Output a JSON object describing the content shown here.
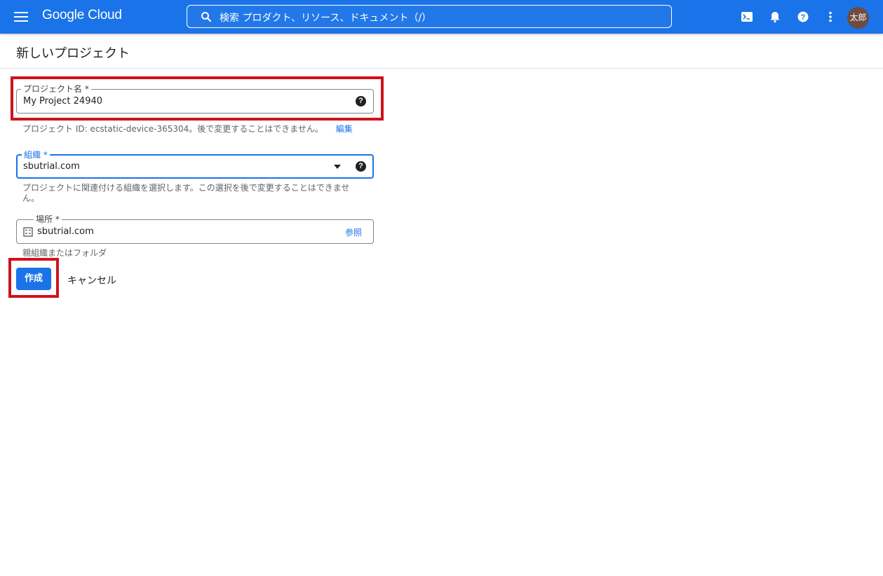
{
  "header": {
    "logo": "Google Cloud",
    "search_placeholder": "検索  プロダクト、リソース、ドキュメント（/）",
    "avatar_text": "太郎"
  },
  "page": {
    "title": "新しいプロジェクト"
  },
  "form": {
    "project_name": {
      "label": "プロジェクト名 *",
      "value": "My Project 24940",
      "hint_prefix": "プロジェクト ID: ecstatic-device-365304。後で変更することはできません。",
      "hint_link": "編集"
    },
    "organization": {
      "label": "組織 *",
      "value": "sbutrial.com",
      "hint_line1": "プロジェクトに関連付ける組織を選択します。この選択を後で変更することはできませ",
      "hint_line2": "ん。"
    },
    "location": {
      "label": "場所 *",
      "value": "sbutrial.com",
      "browse_label": "参照",
      "hint": "親組織またはフォルダ"
    },
    "create_label": "作成",
    "cancel_label": "キャンセル"
  },
  "colors": {
    "brand": "#1a73e8",
    "highlight": "#d0131b"
  },
  "icons": [
    "menu-icon",
    "search-icon",
    "terminal-icon",
    "bell-icon",
    "help-icon",
    "more-vert-icon",
    "building-icon",
    "dropdown-arrow-icon"
  ]
}
